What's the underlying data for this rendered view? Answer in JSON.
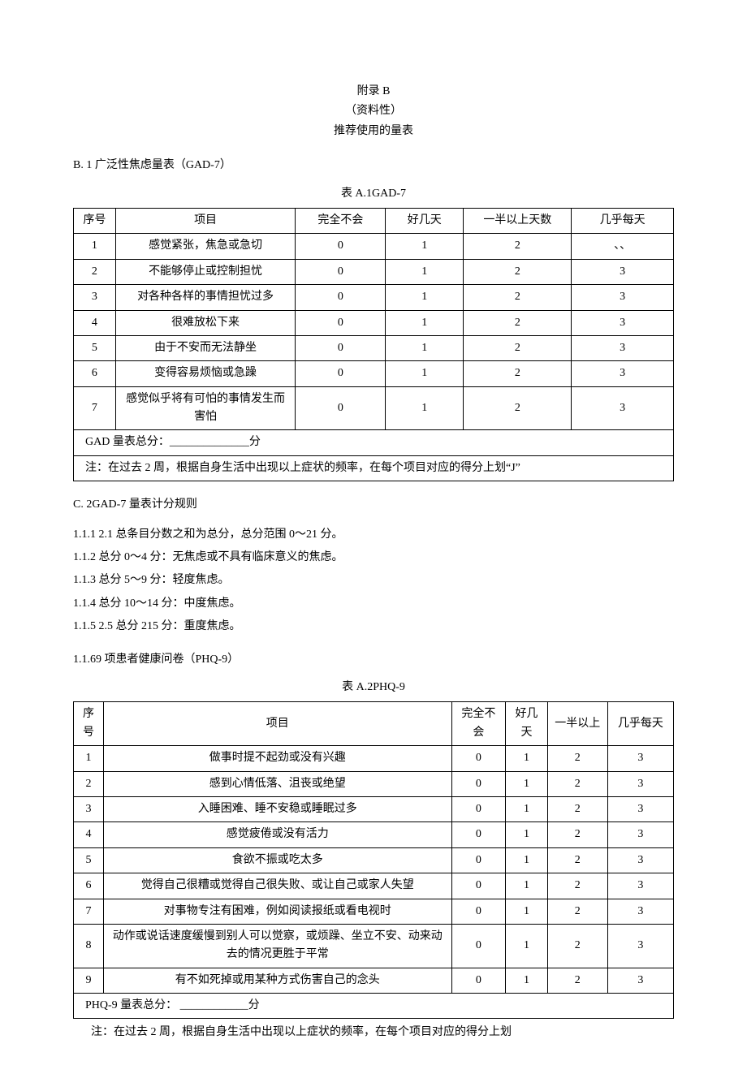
{
  "header": {
    "line1": "附录 B",
    "line2": "（资料性）",
    "line3": "推荐使用的量表"
  },
  "section_b": {
    "heading": "B.  1 广泛性焦虑量表（GAD-7）",
    "caption": "表 A.1GAD-7",
    "headers": [
      "序号",
      "项目",
      "完全不会",
      "好几天",
      "一半以上天数",
      "几乎每天"
    ],
    "rows": [
      {
        "n": "1",
        "item": "感觉紧张，焦急或急切",
        "c0": "0",
        "c1": "1",
        "c2": "2",
        "c3": "、、"
      },
      {
        "n": "2",
        "item": "不能够停止或控制担忧",
        "c0": "0",
        "c1": "1",
        "c2": "2",
        "c3": "3"
      },
      {
        "n": "3",
        "item": "对各种各样的事情担忧过多",
        "c0": "0",
        "c1": "1",
        "c2": "2",
        "c3": "3"
      },
      {
        "n": "4",
        "item": "很难放松下来",
        "c0": "0",
        "c1": "1",
        "c2": "2",
        "c3": "3"
      },
      {
        "n": "5",
        "item": "由于不安而无法静坐",
        "c0": "0",
        "c1": "1",
        "c2": "2",
        "c3": "3"
      },
      {
        "n": "6",
        "item": "变得容易烦恼或急躁",
        "c0": "0",
        "c1": "1",
        "c2": "2",
        "c3": "3"
      },
      {
        "n": "7",
        "item": "感觉似乎将有可怕的事情发生而害怕",
        "c0": "0",
        "c1": "1",
        "c2": "2",
        "c3": "3"
      }
    ],
    "total": "GAD 量表总分：______________分",
    "note": "注：在过去 2 周，根据自身生活中出现以上症状的频率，在每个项目对应的得分上划“J”"
  },
  "section_c": {
    "heading": "C.  2GAD-7 量表计分规则",
    "rules": [
      "1.1.1        2.1 总条目分数之和为总分，总分范围 0～21 分。",
      "1.1.2   总分 0～4 分：无焦虑或不具有临床意义的焦虑。",
      "1.1.3   总分 5～9 分：轻度焦虑。",
      "1.1.4   总分 10～14 分：中度焦虑。",
      "1.1.5        2.5 总分 215 分：重度焦虑。"
    ]
  },
  "section_phq": {
    "heading": "1.1.69 项患者健康问卷（PHQ-9）",
    "caption": "表 A.2PHQ-9",
    "headers": [
      "序号",
      "项目",
      "完全不会",
      "好几天",
      "一半以上",
      "几乎每天"
    ],
    "rows": [
      {
        "n": "1",
        "item": "做事时提不起劲或没有兴趣",
        "c0": "0",
        "c1": "1",
        "c2": "2",
        "c3": "3"
      },
      {
        "n": "2",
        "item": "感到心情低落、沮丧或绝望",
        "c0": "0",
        "c1": "1",
        "c2": "2",
        "c3": "3"
      },
      {
        "n": "3",
        "item": "入睡困难、睡不安稳或睡眠过多",
        "c0": "0",
        "c1": "1",
        "c2": "2",
        "c3": "3"
      },
      {
        "n": "4",
        "item": "感觉疲倦或没有活力",
        "c0": "0",
        "c1": "1",
        "c2": "2",
        "c3": "3"
      },
      {
        "n": "5",
        "item": "食欲不振或吃太多",
        "c0": "0",
        "c1": "1",
        "c2": "2",
        "c3": "3"
      },
      {
        "n": "6",
        "item": "觉得自己很糟或觉得自己很失败、或让自己或家人失望",
        "c0": "0",
        "c1": "1",
        "c2": "2",
        "c3": "3"
      },
      {
        "n": "7",
        "item": "对事物专注有困难，例如阅读报纸或看电视时",
        "c0": "0",
        "c1": "1",
        "c2": "2",
        "c3": "3"
      },
      {
        "n": "8",
        "item": "动作或说话速度缓慢到别人可以觉察，或烦躁、坐立不安、动来动去的情况更胜于平常",
        "c0": "0",
        "c1": "1",
        "c2": "2",
        "c3": "3"
      },
      {
        "n": "9",
        "item": "有不如死掉或用某种方式伤害自己的念头",
        "c0": "0",
        "c1": "1",
        "c2": "2",
        "c3": "3"
      }
    ],
    "total": "PHQ-9 量表总分：  ____________分",
    "note": "注：在过去 2 周，根据自身生活中出现以上症状的频率，在每个项目对应的得分上划"
  }
}
